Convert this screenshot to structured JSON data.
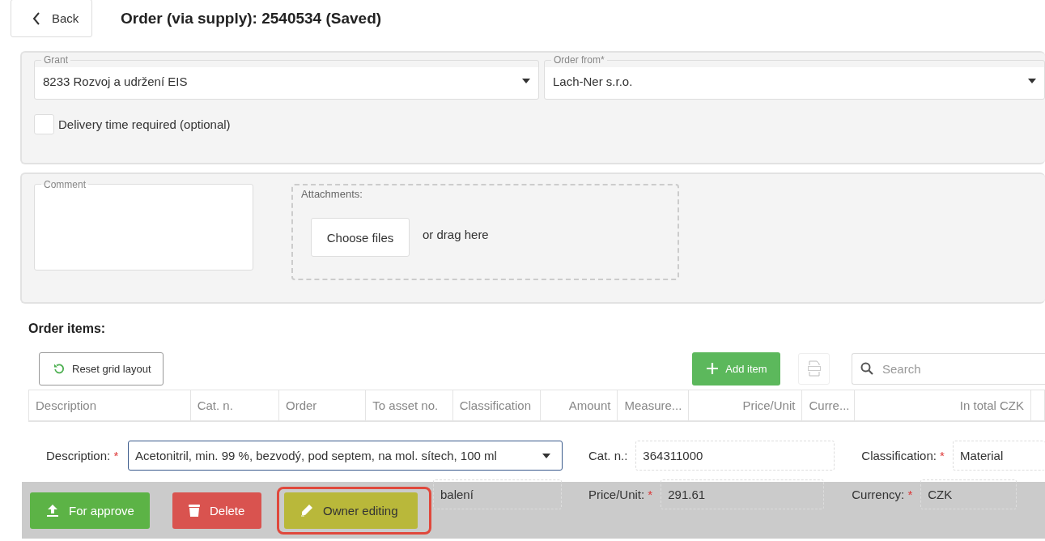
{
  "header": {
    "back": "Back",
    "title": "Order (via supply): 2540534 (Saved)"
  },
  "order_panel": {
    "fields": [
      {
        "label": "Grant",
        "value": "8233 Rozvoj a udržení EIS"
      },
      {
        "label": "Order from*",
        "value": "Lach-Ner s.r.o."
      }
    ],
    "delivery_checkbox": {
      "label": "Delivery time required (optional)",
      "checked": false
    }
  },
  "comment": {
    "label": "Comment"
  },
  "attachments": {
    "label": "Attachments:",
    "button": "Choose files",
    "hint": "or drag here"
  },
  "items": {
    "title": "Order items:",
    "reset_button": "Reset grid layout",
    "add_button": "Add item",
    "search": {
      "placeholder": "Search"
    },
    "columns": [
      "Description",
      "Cat. n.",
      "Order",
      "To asset no.",
      "Classification",
      "Amount",
      "Measure...",
      "Price/Unit",
      "Curre...",
      "In total CZK"
    ],
    "detail_rows": [
      [
        {
          "label": "Description:",
          "required_mark": "*",
          "value": "Acetonitril, min. 99 %, bezvodý, pod septem, na mol. sítech, 100 ml",
          "kind": "select"
        },
        {
          "label": "Cat. n.:",
          "value": "364311000",
          "kind": "readonly"
        },
        {
          "label": "Classification:",
          "required_mark": "*",
          "value": "Material",
          "kind": "readonly"
        }
      ],
      [
        {
          "value": "balení",
          "kind": "readonly"
        },
        {
          "label": "Price/Unit:",
          "required_mark": "*",
          "value": "291.61",
          "kind": "readonly"
        },
        {
          "label": "Currency:",
          "required_mark": "*",
          "value": "CZK",
          "kind": "readonly"
        }
      ]
    ]
  },
  "actions": [
    {
      "label": "For approve",
      "kind": "approve",
      "highlighted": false
    },
    {
      "label": "Delete",
      "kind": "delete",
      "highlighted": false
    },
    {
      "label": "Owner editing",
      "kind": "edit",
      "highlighted": true
    }
  ]
}
